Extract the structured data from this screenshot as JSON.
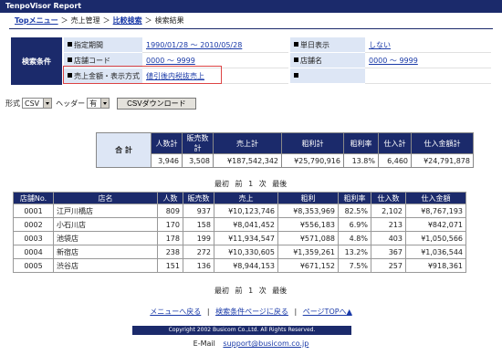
{
  "app": {
    "title": "TenpoVisor Report"
  },
  "breadcrumb": {
    "top": "Topメニュー",
    "sales": "売上管理",
    "compare": "比較検索",
    "current": "検索結果"
  },
  "conditions": {
    "label": "検索条件",
    "period_label": "指定期間",
    "period_value": "1990/01/28 〜 2010/05/28",
    "single_label": "単日表示",
    "single_value": "しない",
    "store_code_label": "店舗コード",
    "store_code_value": "0000 〜 9999",
    "store_name_label": "店舗名",
    "store_name_value": "0000 〜 9999",
    "amount_label": "売上金額・表示方式",
    "amount_value": "値引後内税抜売上"
  },
  "format": {
    "label": "形式",
    "value": "CSV",
    "header_label": "ヘッダー",
    "header_value": "有",
    "download": "CSVダウンロード"
  },
  "summary": {
    "label": "合 計",
    "headers": [
      "人数計",
      "販売数計",
      "売上計",
      "粗利計",
      "粗利率",
      "仕入計",
      "仕入金額計"
    ],
    "values": [
      "3,946",
      "3,508",
      "¥187,542,342",
      "¥25,790,916",
      "13.8%",
      "6,460",
      "¥24,791,878"
    ]
  },
  "pager": {
    "first": "最初",
    "prev": "前",
    "page": "1",
    "next": "次",
    "last": "最後"
  },
  "table": {
    "headers": [
      "店舗No.",
      "店名",
      "人数",
      "販売数",
      "売上",
      "粗利",
      "粗利率",
      "仕入数",
      "仕入金額"
    ],
    "rows": [
      [
        "0001",
        "江戸川橋店",
        "809",
        "937",
        "¥10,123,746",
        "¥8,353,969",
        "82.5%",
        "2,102",
        "¥8,767,193"
      ],
      [
        "0002",
        "小石川店",
        "170",
        "158",
        "¥8,041,452",
        "¥556,183",
        "6.9%",
        "213",
        "¥842,071"
      ],
      [
        "0003",
        "池袋店",
        "178",
        "199",
        "¥11,934,547",
        "¥571,088",
        "4.8%",
        "403",
        "¥1,050,566"
      ],
      [
        "0004",
        "新宿店",
        "238",
        "272",
        "¥10,330,605",
        "¥1,359,261",
        "13.2%",
        "367",
        "¥1,036,544"
      ],
      [
        "0005",
        "渋谷店",
        "151",
        "136",
        "¥8,944,153",
        "¥671,152",
        "7.5%",
        "257",
        "¥918,361"
      ]
    ]
  },
  "footer": {
    "menu_link": "メニューへ戻る",
    "search_link": "検索条件ページに戻る",
    "top_link": "ページTOPへ▲",
    "separator": "|",
    "copyright": "Copyright 2002 Busicom Co.,Ltd. All Rights Reserved.",
    "email_label": "E-Mail",
    "email": "support@busicom.co.jp"
  }
}
